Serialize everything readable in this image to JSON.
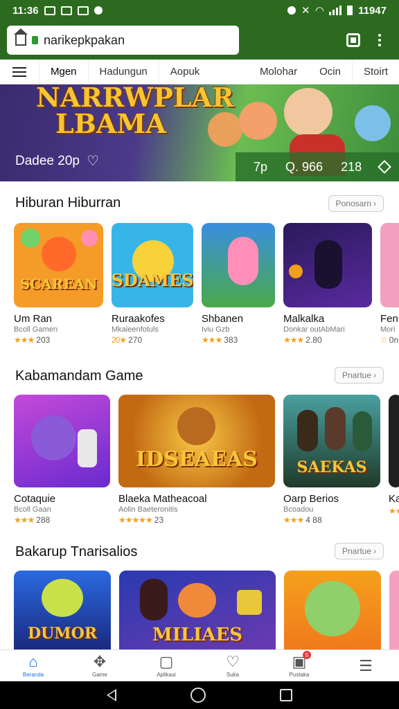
{
  "status": {
    "time": "11:36",
    "clock_right": "11947",
    "icons": [
      "image-icon",
      "message-icon",
      "mail-icon",
      "notify-icon"
    ]
  },
  "browser": {
    "url": "narikepkpakan",
    "icons": [
      "home-icon",
      "lock-icon",
      "tab-switcher-icon",
      "more-icon"
    ]
  },
  "tabs": [
    "Mgen",
    "Hadungun",
    "Aopuk",
    "Molohar",
    "Ocin",
    "Stoirt"
  ],
  "banner": {
    "title_line1": "NARRWPLAR",
    "title_line2": "LBAMA",
    "subtitle": "Dadee 20p",
    "stats": [
      "7p",
      "Q. 966",
      "218"
    ]
  },
  "sections": [
    {
      "title": "Hiburan Hiburran",
      "more": "Ponosarn",
      "cards": [
        {
          "art": "SCAREAN",
          "name": "Um Ran",
          "sub": "Bcoll Gamen",
          "stars": "★★★",
          "rating": "203",
          "bg": "#f59b28",
          "art_color": "#f6c63a"
        },
        {
          "art": "SDAMES",
          "name": "Ruraakofes",
          "sub": "Mkaleenfotuls",
          "stars": "20★",
          "rating": "270",
          "bg": "#37b5e8",
          "art_color": "#f6c63a"
        },
        {
          "art": "",
          "name": "Shbanen",
          "sub": "Iviu Gzb",
          "stars": "★★★",
          "rating": "383",
          "bg": "#4aa94a",
          "art_color": "#ff7fa8"
        },
        {
          "art": "",
          "name": "Malkalka",
          "sub": "Donkar outAbMari",
          "stars": "★★★",
          "rating": "2.80",
          "bg": "#3a2a7a",
          "art_color": "#f6c63a"
        },
        {
          "art": "",
          "name": "Fen",
          "sub": "Mori",
          "stars": "☆",
          "rating": "0n",
          "bg": "#f3a0c0",
          "art_color": "#f6c63a"
        }
      ]
    },
    {
      "title": "Kabamandam Game",
      "more": "Pnartue",
      "cards": [
        {
          "art": "",
          "name": "Cotaquie",
          "sub": "Bcoll Gaan",
          "stars": "★★★",
          "rating": "288",
          "bg": "#8a3ad8",
          "art_color": "#f6c63a"
        },
        {
          "art": "IDSEAEAS",
          "name": "Blaeka Matheacoal",
          "sub": "Aolin Baeteronitis",
          "stars": "★★★★★",
          "rating": "23",
          "bg": "#c26a12",
          "art_color": "#f6c63a"
        },
        {
          "art": "SAEKAS",
          "name": "Oarp Berios",
          "sub": "Bcoadou",
          "stars": "★★★",
          "rating": "4 88",
          "bg": "#2f6a3a",
          "art_color": "#f6c63a"
        },
        {
          "art": "",
          "name": "Ka",
          "sub": "",
          "stars": "★★",
          "rating": "",
          "bg": "#202020",
          "art_color": "#f6c63a"
        }
      ]
    },
    {
      "title": "Bakarup Tnarisalios",
      "more": "Pnartue",
      "cards": [
        {
          "art": "DUMOR",
          "name": "",
          "sub": "",
          "stars": "",
          "rating": "",
          "bg": "#1f4fb8",
          "art_color": "#f6c63a"
        },
        {
          "art": "MILIAES",
          "name": "",
          "sub": "",
          "stars": "",
          "rating": "",
          "bg": "#3c3a9a",
          "art_color": "#f6c63a"
        },
        {
          "art": "",
          "name": "",
          "sub": "",
          "stars": "",
          "rating": "",
          "bg": "#f07a1c",
          "art_color": "#f6c63a"
        },
        {
          "art": "",
          "name": "",
          "sub": "",
          "stars": "",
          "rating": "",
          "bg": "#f3a0c0",
          "art_color": "#f6c63a"
        }
      ]
    }
  ],
  "bottom_nav": [
    {
      "icon": "home-icon",
      "label": "Beranda",
      "active": true
    },
    {
      "icon": "games-icon",
      "label": "Game",
      "active": false
    },
    {
      "icon": "apps-icon",
      "label": "Aplikasi",
      "active": false
    },
    {
      "icon": "heart-icon",
      "label": "Suka",
      "active": false
    },
    {
      "icon": "library-icon",
      "label": "Pustaka",
      "active": false,
      "badge": "5"
    },
    {
      "icon": "menu-icon",
      "label": "",
      "active": false
    }
  ],
  "colors": {
    "accent_green": "#2c6b1f",
    "nav_active": "#1a73e8",
    "star": "#f2a01a"
  }
}
